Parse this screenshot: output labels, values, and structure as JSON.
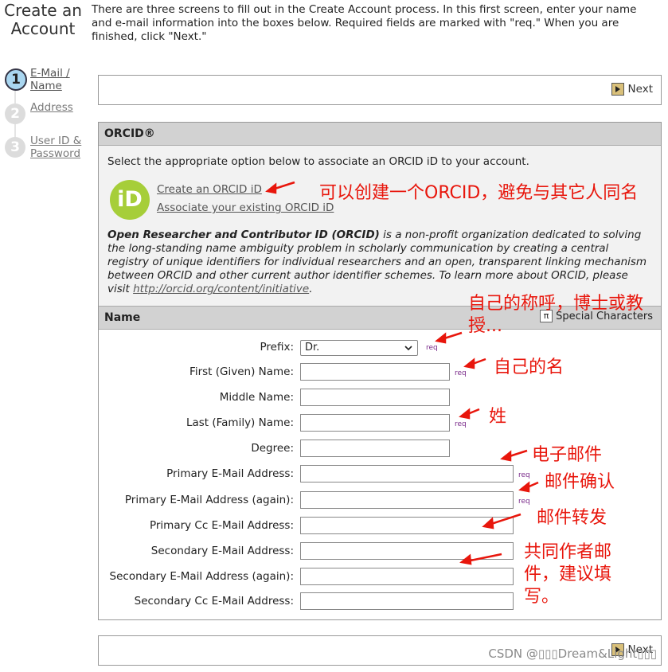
{
  "page_title": "Create an Account",
  "intro": "There are three screens to fill out in the Create Account process. In this first screen, enter your name and e-mail information into the boxes below. Required fields are marked with \"req.\" When you are finished, click \"Next.\"",
  "steps": [
    {
      "number": "1",
      "label": "E-Mail / Name"
    },
    {
      "number": "2",
      "label": "Address"
    },
    {
      "number": "3",
      "label": "User ID & Password"
    }
  ],
  "nav": {
    "next_label": "Next"
  },
  "orcid": {
    "header": "ORCID®",
    "intro": "Select the appropriate option below to associate an ORCID iD to your account.",
    "logo_text": "iD",
    "create_link": "Create an ORCID iD",
    "associate_link": "Associate your existing ORCID iD",
    "desc_bold": "Open Researcher and Contributor ID (ORCID)",
    "desc_text": " is a non-profit organization dedicated to solving the long-standing name ambiguity problem in scholarly communication by creating a central registry of unique identifiers for individual researchers and an open, transparent linking mechanism between ORCID and other current author identifier schemes. To learn more about ORCID, please visit ",
    "desc_link": "http://orcid.org/content/initiative",
    "desc_end": "."
  },
  "name_section": {
    "header": "Name",
    "special_chars": "Special Characters",
    "special_icon": "π",
    "prefix_label": "Prefix:",
    "prefix_value": "Dr.",
    "req": "req",
    "fields": [
      {
        "label": "First (Given) Name:"
      },
      {
        "label": "Middle Name:"
      },
      {
        "label": "Last (Family) Name:"
      },
      {
        "label": "Degree:"
      },
      {
        "label": "Primary E-Mail Address:"
      },
      {
        "label": "Primary E-Mail Address (again):"
      },
      {
        "label": "Primary Cc E-Mail Address:"
      },
      {
        "label": "Secondary E-Mail Address:"
      },
      {
        "label": "Secondary E-Mail Address (again):"
      },
      {
        "label": "Secondary Cc E-Mail Address:"
      }
    ]
  },
  "annotations": {
    "orcid_note": "可以创建一个ORCID，避免与其它人同名",
    "prefix_note": "自己的称呼，博士或教授...",
    "first_name_note": "自己的名",
    "last_name_note": "姓",
    "email_note": "电子邮件",
    "email_confirm_note": "邮件确认",
    "cc_note": "邮件转发",
    "secondary_note": "共同作者邮件，建议填写。"
  },
  "watermark": "CSDN @▯▯▯Dream&Light▯▯▯",
  "annotation_color": "#e8160c",
  "orcid_color": "#a6ce39"
}
